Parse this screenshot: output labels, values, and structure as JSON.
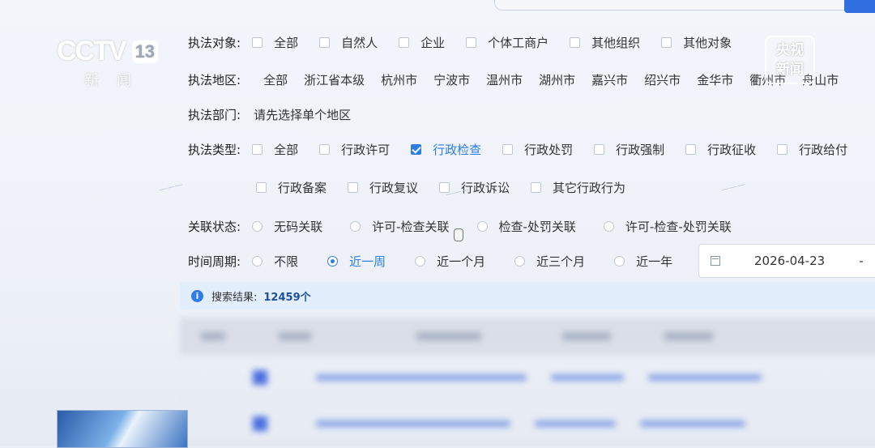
{
  "broadcast": {
    "channel_logo": "CCTV",
    "channel_number": "13",
    "channel_sub": "新闻",
    "badge_line1": "央视",
    "badge_line2": "新闻"
  },
  "filters": {
    "target": {
      "label": "执法对象:",
      "options": [
        {
          "text": "全部",
          "checked": false
        },
        {
          "text": "自然人",
          "checked": false
        },
        {
          "text": "企业",
          "checked": false
        },
        {
          "text": "个体工商户",
          "checked": false
        },
        {
          "text": "其他组织",
          "checked": false
        },
        {
          "text": "其他对象",
          "checked": false
        }
      ]
    },
    "region": {
      "label": "执法地区:",
      "options": [
        "全部",
        "浙江省本级",
        "杭州市",
        "宁波市",
        "温州市",
        "湖州市",
        "嘉兴市",
        "绍兴市",
        "金华市",
        "衢州市",
        "舟山市"
      ]
    },
    "department": {
      "label": "执法部门:",
      "hint": "请先选择单个地区"
    },
    "type": {
      "label": "执法类型:",
      "options_row1": [
        {
          "text": "全部",
          "checked": false
        },
        {
          "text": "行政许可",
          "checked": false
        },
        {
          "text": "行政检查",
          "checked": true
        },
        {
          "text": "行政处罚",
          "checked": false
        },
        {
          "text": "行政强制",
          "checked": false
        },
        {
          "text": "行政征收",
          "checked": false
        },
        {
          "text": "行政给付",
          "checked": false
        }
      ],
      "options_row2": [
        {
          "text": "行政备案",
          "checked": false
        },
        {
          "text": "行政复议",
          "checked": false
        },
        {
          "text": "行政诉讼",
          "checked": false
        },
        {
          "text": "其它行政行为",
          "checked": false
        }
      ]
    },
    "link_status": {
      "label": "关联状态:",
      "options": [
        {
          "text": "无码关联",
          "selected": false
        },
        {
          "text": "许可-检查关联",
          "selected": false
        },
        {
          "text": "检查-处罚关联",
          "selected": false
        },
        {
          "text": "许可-检查-处罚关联",
          "selected": false
        }
      ]
    },
    "period": {
      "label": "时间周期:",
      "options": [
        {
          "text": "不限",
          "selected": false
        },
        {
          "text": "近一周",
          "selected": true
        },
        {
          "text": "近一个月",
          "selected": false
        },
        {
          "text": "近三个月",
          "selected": false
        },
        {
          "text": "近一年",
          "selected": false
        }
      ],
      "date_start": "2026-04-23",
      "date_separator": "-"
    }
  },
  "result": {
    "label": "搜索结果:",
    "count": "12459个"
  },
  "colors": {
    "accent": "#2e7de6",
    "result_bar": "#e3eefc"
  }
}
